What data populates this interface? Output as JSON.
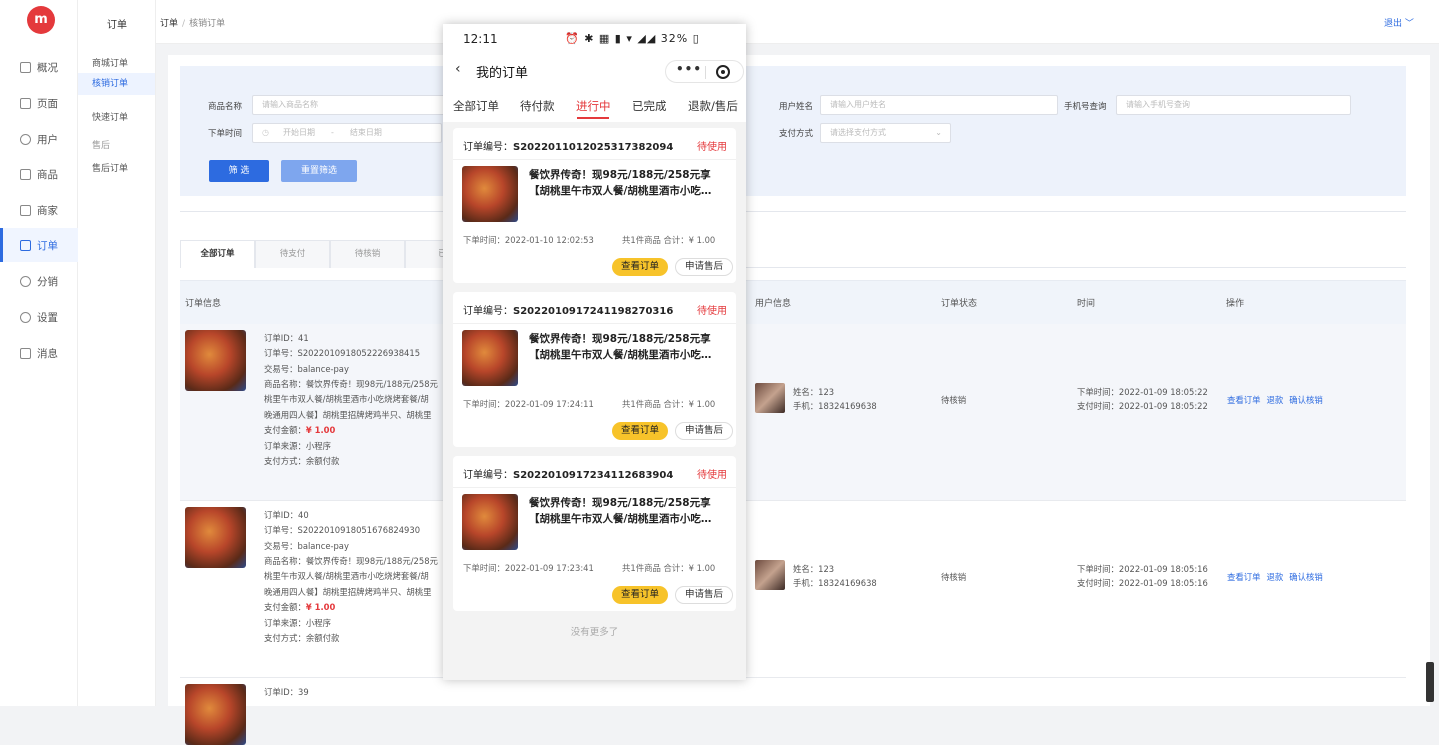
{
  "app": {
    "logo_text": "m"
  },
  "left_nav": {
    "items": [
      {
        "label": "概况",
        "icon": "monitor-icon"
      },
      {
        "label": "页面",
        "icon": "page-icon"
      },
      {
        "label": "用户",
        "icon": "user-icon"
      },
      {
        "label": "商品",
        "icon": "cube-icon"
      },
      {
        "label": "商家",
        "icon": "store-icon"
      },
      {
        "label": "订单",
        "icon": "order-icon",
        "active": true
      },
      {
        "label": "分销",
        "icon": "network-icon"
      },
      {
        "label": "设置",
        "icon": "gear-icon"
      },
      {
        "label": "消息",
        "icon": "speaker-icon"
      }
    ]
  },
  "sub_nav": {
    "title": "订单",
    "items": [
      "商城订单",
      "核销订单",
      "快速订单",
      "售后",
      "售后订单"
    ]
  },
  "topbar": {
    "breadcrumb_root": "订单",
    "breadcrumb_sep": "/",
    "breadcrumb_current": "核销订单",
    "logout": "退出 ﹀"
  },
  "filter": {
    "product_name_label": "商品名称",
    "product_name_placeholder": "请输入商品名称",
    "user_name_label": "用户姓名",
    "user_name_placeholder": "请输入用户姓名",
    "phone_label": "手机号查询",
    "phone_placeholder": "请输入手机号查询",
    "time_label": "下单时间",
    "start_placeholder": "开始日期",
    "range_sep": "-",
    "end_placeholder": "结束日期",
    "pay_label": "支付方式",
    "pay_placeholder": "请选择支付方式",
    "filter_button": "筛 选",
    "reset_button": "重置筛选"
  },
  "tabs": [
    "全部订单",
    "待支付",
    "待核销",
    "已"
  ],
  "table": {
    "headers": [
      "订单信息",
      "用户信息",
      "订单状态",
      "时间",
      "操作"
    ]
  },
  "orders": [
    {
      "id": "订单ID：41",
      "no": "订单号：S2022010918052226938415",
      "trade": "交易号：balance-pay",
      "name1": "商品名称：餐饮界传奇！现98元/188元/258元",
      "name2": "桃里午市双人餐/胡桃里酒市小吃烧烤套餐/胡",
      "name3": "晚通用四人餐】胡桃里招牌烤鸡半只、胡桃里",
      "pay_label": "支付金额：",
      "pay": "¥ 1.00",
      "source": "订单来源：小程序",
      "method": "支付方式：余额付款",
      "uname": "姓名：123",
      "uphone": "手机：18324169638",
      "status": "待核销",
      "order_time": "下单时间：2022-01-09 18:05:22",
      "pay_time": "支付时间：2022-01-09 18:05:22",
      "actions": [
        "查看订单",
        "退款",
        "确认核销"
      ]
    },
    {
      "id": "订单ID：40",
      "no": "订单号：S2022010918051676824930",
      "trade": "交易号：balance-pay",
      "name1": "商品名称：餐饮界传奇！现98元/188元/258元",
      "name2": "桃里午市双人餐/胡桃里酒市小吃烧烤套餐/胡",
      "name3": "晚通用四人餐】胡桃里招牌烤鸡半只、胡桃里",
      "pay_label": "支付金额：",
      "pay": "¥ 1.00",
      "source": "订单来源：小程序",
      "method": "支付方式：余额付款",
      "uname": "姓名：123",
      "uphone": "手机：18324169638",
      "status": "待核销",
      "order_time": "下单时间：2022-01-09 18:05:16",
      "pay_time": "支付时间：2022-01-09 18:05:16",
      "actions": [
        "查看订单",
        "退款",
        "确认核销"
      ]
    },
    {
      "id": "订单ID：39"
    }
  ],
  "phone": {
    "time": "12:11",
    "status_icons": "⏰ ✱ ▦ ▮ ▾ ◢◢ 32% ▯",
    "back": "‹",
    "title": "我的订单",
    "capsule_dots": "•••",
    "tabs": [
      "全部订单",
      "待付款",
      "进行中",
      "已完成",
      "退款/售后"
    ],
    "cards": [
      {
        "sn_label": "订单编号：",
        "sn": "S2022011012025317382094",
        "status": "待使用",
        "name": "餐饮界传奇！现98元/188元/258元享【胡桃里午市双人餐/胡桃里酒市小吃…",
        "time": "下单时间：2022-01-10 12:02:53",
        "sum": "共1件商品  合计：¥ 1.00",
        "btn1": "查看订单",
        "btn2": "申请售后"
      },
      {
        "sn_label": "订单编号：",
        "sn": "S2022010917241198270316",
        "status": "待使用",
        "name": "餐饮界传奇！现98元/188元/258元享【胡桃里午市双人餐/胡桃里酒市小吃…",
        "time": "下单时间：2022-01-09 17:24:11",
        "sum": "共1件商品  合计：¥ 1.00",
        "btn1": "查看订单",
        "btn2": "申请售后"
      },
      {
        "sn_label": "订单编号：",
        "sn": "S2022010917234112683904",
        "status": "待使用",
        "name": "餐饮界传奇！现98元/188元/258元享【胡桃里午市双人餐/胡桃里酒市小吃…",
        "time": "下单时间：2022-01-09 17:23:41",
        "sum": "共1件商品  合计：¥ 1.00",
        "btn1": "查看订单",
        "btn2": "申请售后"
      }
    ],
    "no_more": "没有更多了"
  },
  "colors": {
    "primary": "#2d6be0",
    "danger": "#e4393c",
    "yellow": "#f7c32a"
  }
}
